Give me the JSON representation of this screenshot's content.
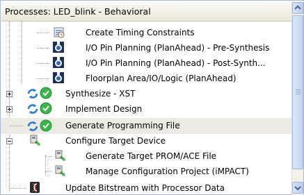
{
  "panel": {
    "title": "Processes: LED_blink - Behavioral"
  },
  "tree": {
    "items": [
      {
        "label": "Create Timing Constraints",
        "icon": "timing-constraints-icon"
      },
      {
        "label": "I/O Pin Planning (PlanAhead) - Pre-Synthesis",
        "icon": "planahead-icon"
      },
      {
        "label": "I/O Pin Planning (PlanAhead) - Post-Synth...",
        "icon": "planahead-icon"
      },
      {
        "label": "Floorplan Area/IO/Logic (PlanAhead)",
        "icon": "planahead-icon"
      },
      {
        "label": "Synthesize - XST",
        "icon": "process-ok-icon"
      },
      {
        "label": "Implement Design",
        "icon": "process-ok-icon"
      },
      {
        "label": "Generate Programming File",
        "icon": "process-ok-icon"
      },
      {
        "label": "Configure Target Device",
        "icon": "configure-device-icon"
      },
      {
        "label": "Generate Target PROM/ACE File",
        "icon": "prom-file-icon"
      },
      {
        "label": "Manage Configuration Project (iMPACT)",
        "icon": "impact-icon"
      },
      {
        "label": "Update Bitstream with Processor Data",
        "icon": "bitstream-icon"
      }
    ]
  },
  "colors": {
    "selection": "#ecebe3",
    "success_green": "#39b54a",
    "refresh_blue": "#2a7fd4"
  }
}
